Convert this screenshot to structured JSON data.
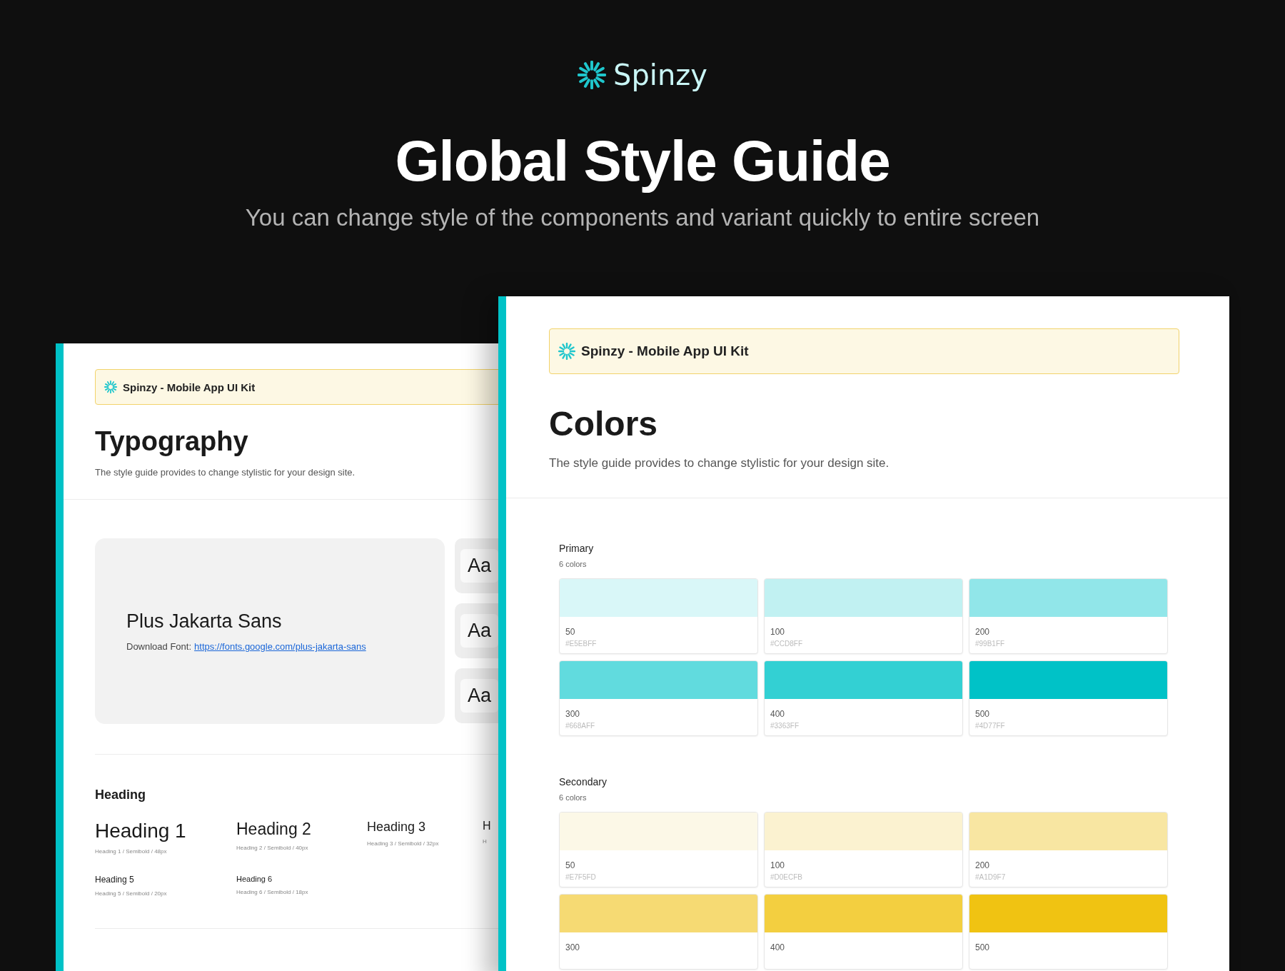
{
  "brand": {
    "name": "Spinzy"
  },
  "hero": {
    "title": "Global Style Guide",
    "subtitle": "You can change style of the components and variant quickly to entire screen"
  },
  "typography_page": {
    "banner": "Spinzy - Mobile App UI Kit",
    "title": "Typography",
    "description": "The style guide provides to change stylistic for your design site.",
    "font_card": {
      "name": "Plus Jakarta Sans",
      "download_label": "Download Font:",
      "link": "https://fonts.google.com/plus-jakarta-sans"
    },
    "samples": [
      "Aa",
      "Aa",
      "Aa"
    ],
    "heading_section": "Heading",
    "headings": [
      {
        "kind": "h1",
        "text": "Heading 1",
        "caption": "Heading 1 / Semibold / 48px"
      },
      {
        "kind": "h2",
        "text": "Heading 2",
        "caption": "Heading 2 / Semibold / 40px"
      },
      {
        "kind": "h3",
        "text": "Heading 3",
        "caption": "Heading 3 / Semibold / 32px"
      },
      {
        "kind": "h4",
        "text": "H",
        "caption": "H"
      },
      {
        "kind": "h5",
        "text": "Heading 5",
        "caption": "Heading 5 / Semibold / 20px"
      },
      {
        "kind": "h6",
        "text": "Heading 6",
        "caption": "Heading 6 / Semibold / 18px"
      }
    ]
  },
  "colors_page": {
    "banner": "Spinzy - Mobile App UI Kit",
    "title": "Colors",
    "description": "The style guide provides to change stylistic for your design site.",
    "groups": [
      {
        "name": "Primary",
        "count": "6 colors",
        "swatches": [
          {
            "shade": "50",
            "code": "#E5EBFF",
            "color": "#d9f7f8"
          },
          {
            "shade": "100",
            "code": "#CCD8FF",
            "color": "#c1f1f2"
          },
          {
            "shade": "200",
            "code": "#99B1FF",
            "color": "#91e6e9"
          },
          {
            "shade": "300",
            "code": "#668AFF",
            "color": "#61dbde"
          },
          {
            "shade": "400",
            "code": "#3363FF",
            "color": "#33d0d3"
          },
          {
            "shade": "500",
            "code": "#4D77FF",
            "color": "#00c2c7"
          }
        ]
      },
      {
        "name": "Secondary",
        "count": "6 colors",
        "swatches": [
          {
            "shade": "50",
            "code": "#E7F5FD",
            "color": "#fcf8e7"
          },
          {
            "shade": "100",
            "code": "#D0ECFB",
            "color": "#fbf2d0"
          },
          {
            "shade": "200",
            "code": "#A1D9F7",
            "color": "#f8e6a2"
          },
          {
            "shade": "300",
            "color": "#f6da73"
          },
          {
            "shade": "400",
            "color": "#f3cf40"
          },
          {
            "shade": "500",
            "color": "#f0c312"
          }
        ]
      }
    ]
  }
}
